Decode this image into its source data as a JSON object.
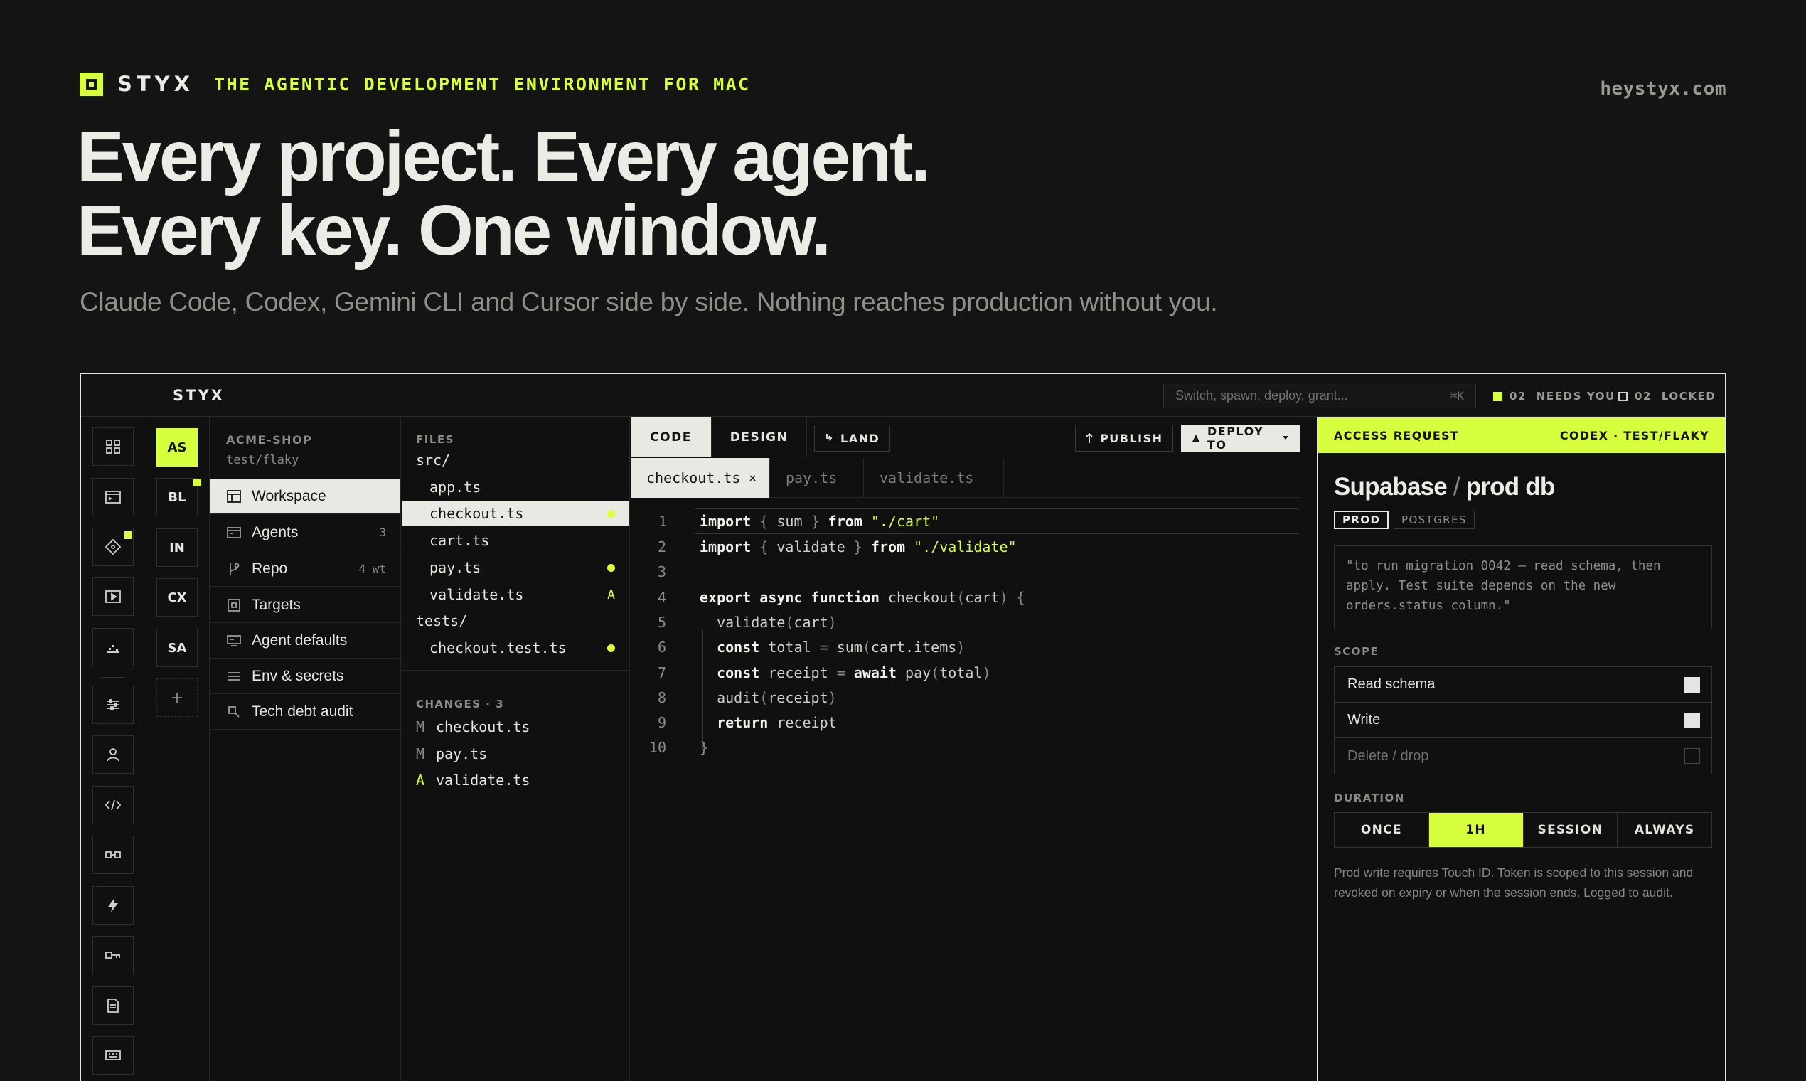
{
  "hero": {
    "brand": "STYX",
    "tagline": "THE AGENTIC DEVELOPMENT ENVIRONMENT FOR MAC",
    "site": "heystyx.com",
    "headline_1": "Every project. Every agent.",
    "headline_2": "Every key. One window.",
    "subhead": "Claude Code, Codex, Gemini CLI and Cursor side by side. Nothing reaches production without you."
  },
  "app": {
    "title": "STYX",
    "command_placeholder": "Switch, spawn, deploy, grant...",
    "command_shortcut": "⌘K",
    "status_needs": "02  NEEDS YOU",
    "status_locked": "02  LOCKED",
    "accent": "#d8ff3e"
  },
  "rail": {
    "icons": [
      "dashboard-icon",
      "terminal-icon",
      "diamond-icon",
      "play-icon",
      "chart-icon",
      "sliders-icon",
      "user-icon",
      "code-icon",
      "link-icon",
      "bolt-icon",
      "key-icon",
      "document-icon",
      "keyboard-icon"
    ]
  },
  "projects": {
    "items": [
      "AS",
      "BL",
      "IN",
      "CX",
      "SA"
    ],
    "add": "+"
  },
  "nav": {
    "org": "ACME-SHOP",
    "branch": "test/flaky",
    "items": [
      {
        "label": "Workspace",
        "count": ""
      },
      {
        "label": "Agents",
        "count": "3"
      },
      {
        "label": "Repo",
        "count": "4 wt"
      },
      {
        "label": "Targets",
        "count": ""
      },
      {
        "label": "Agent defaults",
        "count": ""
      },
      {
        "label": "Env & secrets",
        "count": ""
      },
      {
        "label": "Tech debt audit",
        "count": ""
      }
    ]
  },
  "files": {
    "header": "FILES",
    "tree": [
      "src/",
      "app.ts",
      "checkout.ts",
      "cart.ts",
      "pay.ts",
      "validate.ts",
      "tests/",
      "checkout.test.ts"
    ],
    "added_marker": "A",
    "changes_header": "CHANGES · 3",
    "changes": [
      {
        "status": "M",
        "file": "checkout.ts"
      },
      {
        "status": "M",
        "file": "pay.ts"
      },
      {
        "status": "A",
        "file": "validate.ts"
      }
    ]
  },
  "editor": {
    "tabs": [
      "CODE",
      "DESIGN"
    ],
    "land": "LAND",
    "publish": "PUBLISH",
    "deploy": "DEPLOY TO",
    "file_tabs": [
      "checkout.ts",
      "pay.ts",
      "validate.ts"
    ],
    "close": "×",
    "line_numbers": [
      "1",
      "2",
      "3",
      "4",
      "5",
      "6",
      "7",
      "8",
      "9",
      "10"
    ]
  },
  "access": {
    "header": "ACCESS REQUEST",
    "requester": "CODEX · TEST/FLAKY",
    "service": "Supabase",
    "separator": "/",
    "resource": "prod db",
    "tags": [
      "PROD",
      "POSTGRES"
    ],
    "reason": "\"to run migration 0042 — read schema, then apply. Test suite depends on the new orders.status column.\"",
    "scope_label": "SCOPE",
    "scope": [
      {
        "label": "Read schema",
        "checked": true
      },
      {
        "label": "Write",
        "checked": true
      },
      {
        "label": "Delete / drop",
        "checked": false
      }
    ],
    "duration_label": "DURATION",
    "durations": [
      "ONCE",
      "1H",
      "SESSION",
      "ALWAYS"
    ],
    "selected_duration": "1H",
    "note": "Prod write requires Touch ID. Token is scoped to this session and revoked on expiry or when the session ends. Logged to audit."
  }
}
